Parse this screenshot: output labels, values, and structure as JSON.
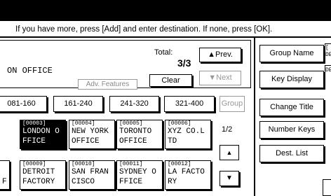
{
  "message": "If you have more, press [Add] and enter destination. If none, press [OK].",
  "destination": {
    "name": "ON OFFICE",
    "total_label": "Total:",
    "total_value": "3/3",
    "adv_features": "Adv. Features"
  },
  "buttons": {
    "prev": "▲Prev.",
    "next": "▼Next",
    "clear": "Clear"
  },
  "tabs": [
    "081-160",
    "161-240",
    "241-320",
    "321-400",
    "Group"
  ],
  "entries": [
    {
      "num": "[00003]",
      "line1": "LONDON O",
      "line2": "FFICE",
      "selected": true
    },
    {
      "num": "[00004]",
      "line1": "NEW YORK",
      "line2": " OFFICE",
      "selected": false
    },
    {
      "num": "[00005]",
      "line1": "TORONTO",
      "line2": "OFFICE",
      "selected": false
    },
    {
      "num": "[00006]",
      "line1": "XYZ CO.L",
      "line2": "TD",
      "selected": false
    },
    {
      "num": "[00009]",
      "line1": "DETROIT",
      "line2": "FACTORY",
      "selected": false
    },
    {
      "num": "[00010]",
      "line1": "SAN FRAN",
      "line2": "CISCO",
      "selected": false
    },
    {
      "num": "[00011]",
      "line1": "SYDNEY O",
      "line2": "FFICE",
      "selected": false
    },
    {
      "num": "[00012]",
      "line1": "LA FACTO",
      "line2": "RY",
      "selected": false
    }
  ],
  "partial_left": {
    "row2_char": "F"
  },
  "page_indicator": "1/2",
  "scroll": {
    "up": "▲",
    "down": "▼"
  },
  "side_buttons": [
    "Group Name",
    "Key Display",
    "Change Title",
    "Number Keys",
    "Dest. List"
  ],
  "edge_text": {
    "a1": "[",
    "a2": "DE",
    "b1": "DE"
  }
}
